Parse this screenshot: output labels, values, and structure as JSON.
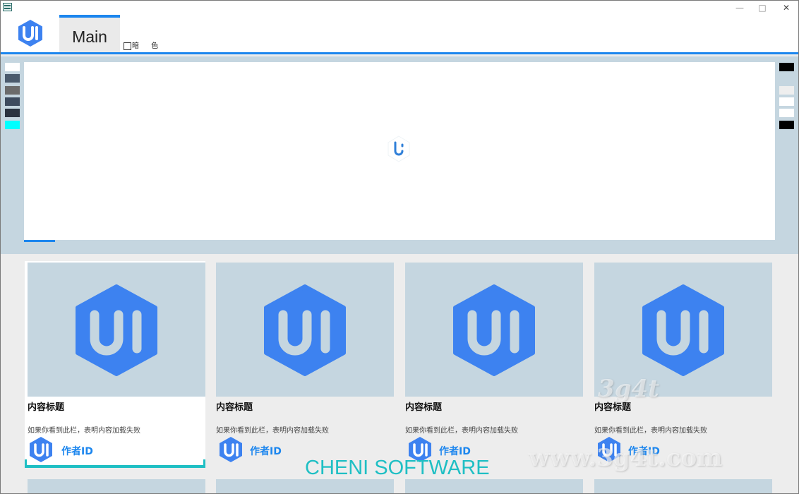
{
  "window": {
    "controls": {
      "minimize": "—",
      "maximize": "□",
      "close": "✕"
    }
  },
  "header": {
    "tab_label": "Main",
    "dark_mode": {
      "label": "暗 色",
      "checked": false
    }
  },
  "banner": {
    "left_swatches": [
      "#ffffff",
      "#4a5a6c",
      "#6b6b6b",
      "#3d4b5e",
      "#2a3340",
      "#00ffff"
    ],
    "right_swatches": [
      "#000000",
      "#eeeeee",
      "#ffffff",
      "#ffffff",
      "#000000"
    ]
  },
  "cards": [
    {
      "title": "内容标题",
      "desc": "如果你看到此栏，表明内容加载失败",
      "author": "作者ID",
      "selected": true
    },
    {
      "title": "内容标题",
      "desc": "如果你看到此栏，表明内容加载失败",
      "author": "作者ID",
      "selected": false
    },
    {
      "title": "内容标题",
      "desc": "如果你看到此栏，表明内容加载失败",
      "author": "作者ID",
      "selected": false
    },
    {
      "title": "内容标题",
      "desc": "如果你看到此栏，表明内容加载失败",
      "author": "作者ID",
      "selected": false
    }
  ],
  "footer": {
    "brand": "CHENI SOFTWARE"
  },
  "watermark": {
    "line1": "3g4t",
    "line2": "www.3g4t.com"
  },
  "colors": {
    "accent": "#1c86ee",
    "highlight": "#1fbfc4",
    "thumb_bg": "#c5d6e0",
    "logo_blue": "#3d82f0"
  }
}
